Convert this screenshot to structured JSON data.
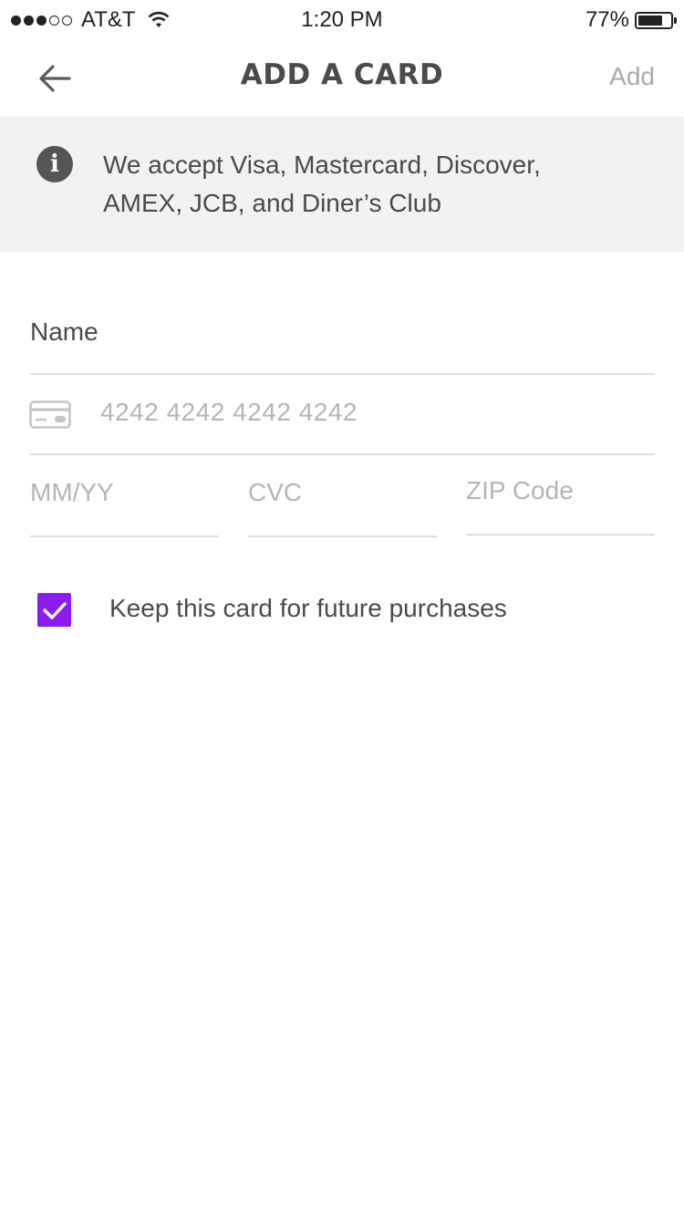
{
  "status_bar": {
    "carrier": "AT&T",
    "time": "1:20 PM",
    "battery_percent": "77%",
    "battery_level": 0.77,
    "signal_bars_filled": 3,
    "signal_bars_total": 5
  },
  "nav": {
    "title": "ADD A CARD",
    "back_icon": "arrow-left-icon",
    "add_label": "Add"
  },
  "info": {
    "icon": "info-icon",
    "icon_glyph": "i",
    "message": "We accept Visa, Mastercard, Discover, AMEX, JCB, and Diner’s Club"
  },
  "form": {
    "name_placeholder": "Name",
    "card_icon": "credit-card-icon",
    "card_number_placeholder": "4242 4242 4242 4242",
    "expiry_placeholder": "MM/YY",
    "cvc_placeholder": "CVC",
    "zip_placeholder": "ZIP Code"
  },
  "save_card": {
    "checked": true,
    "label": "Keep this card for future purchases"
  },
  "colors": {
    "accent": "#8a1cf0",
    "banner_bg": "#f2f2f4",
    "text": "#4a4a4a",
    "placeholder": "#b5b5b5",
    "divider": "#dcdcdc"
  }
}
